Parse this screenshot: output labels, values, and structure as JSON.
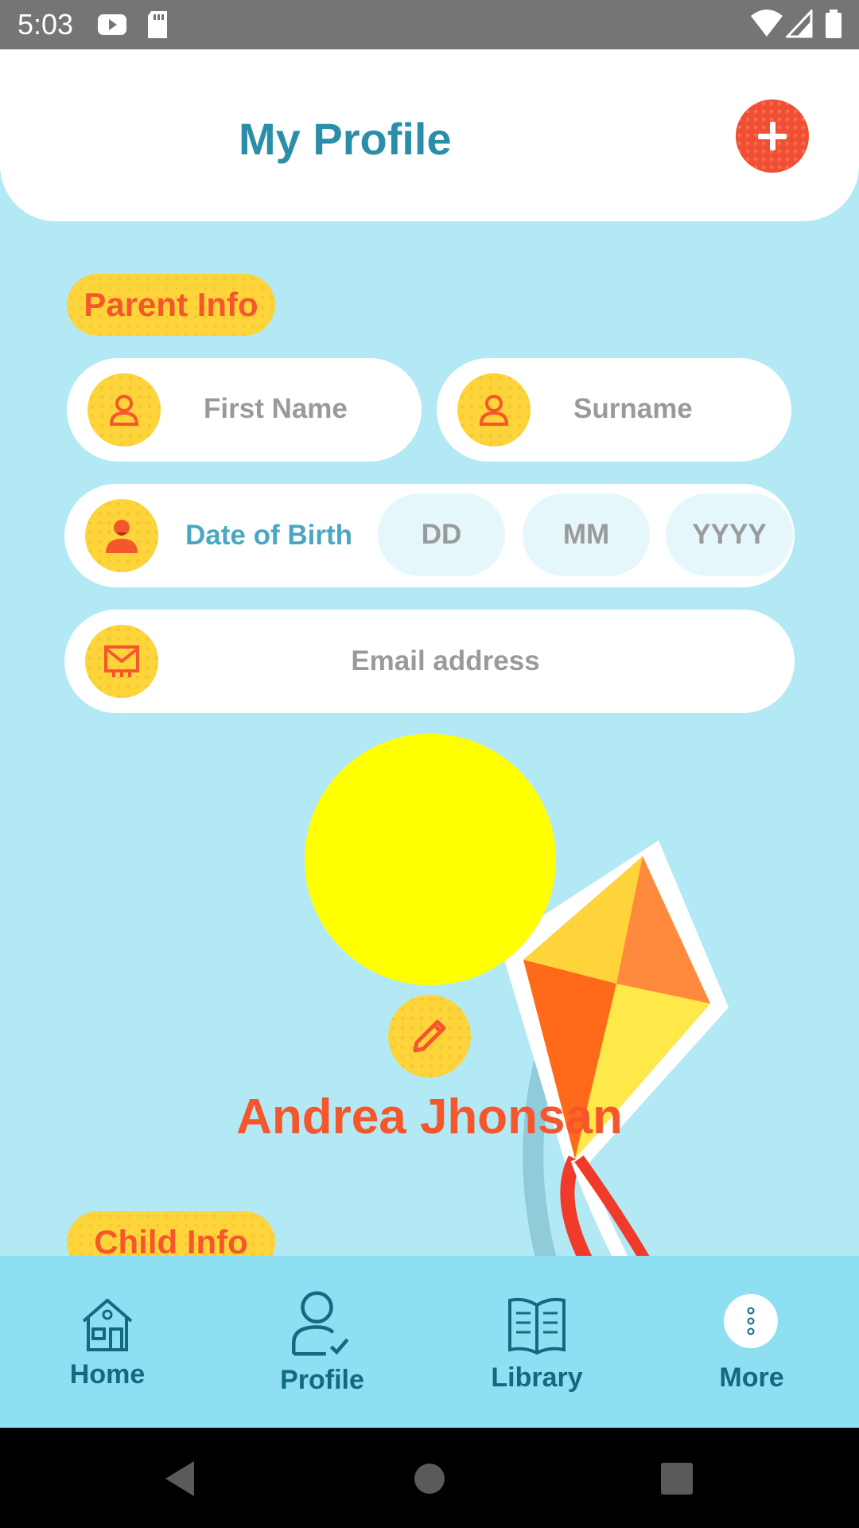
{
  "status_bar": {
    "time": "5:03"
  },
  "header": {
    "title": "My Profile"
  },
  "parent_section": {
    "label": "Parent Info",
    "first_name_placeholder": "First Name",
    "surname_placeholder": "Surname",
    "dob_label": "Date of Birth",
    "dob_day_placeholder": "DD",
    "dob_month_placeholder": "MM",
    "dob_year_placeholder": "YYYY",
    "email_placeholder": "Email address"
  },
  "profile": {
    "name": "Andrea Jhonsan"
  },
  "child_section": {
    "label": "Child Info"
  },
  "bottom_nav": {
    "items": [
      {
        "label": "Home",
        "icon": "home-icon"
      },
      {
        "label": "Profile",
        "icon": "profile-icon"
      },
      {
        "label": "Library",
        "icon": "book-icon"
      },
      {
        "label": "More",
        "icon": "more-icon"
      }
    ]
  },
  "colors": {
    "accent_orange": "#f5572d",
    "accent_yellow": "#fdd53a",
    "title_teal": "#2a8ea8",
    "background": "#b3e9f4",
    "nav_background": "#8ddff1"
  }
}
